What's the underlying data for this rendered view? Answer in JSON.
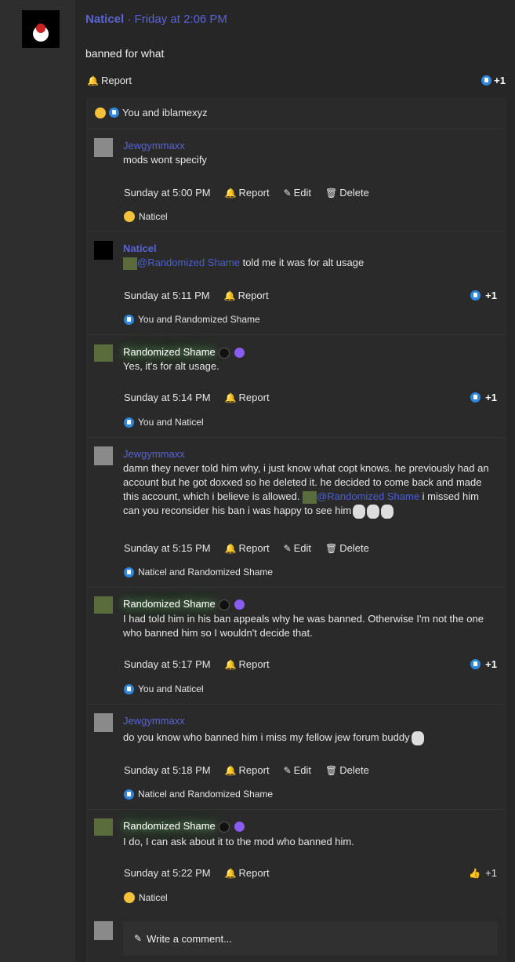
{
  "post": {
    "author": "Naticel",
    "separator": "·",
    "time": "Friday at 2:06 PM",
    "body": "banned for what",
    "report_label": "Report",
    "like_count": "+1",
    "reactions_summary": "You and iblamexyz"
  },
  "comments": [
    {
      "author": "Jewgymmaxx",
      "text": "mods wont specify",
      "time": "Sunday at 5:00 PM",
      "report": "Report",
      "edit": "Edit",
      "delete": "Delete",
      "reaction_text": "Naticel"
    },
    {
      "author": "Naticel",
      "mention": "@Randomized Shame",
      "text": " told me it was for alt usage",
      "time": "Sunday at 5:11 PM",
      "report": "Report",
      "like_count": "+1",
      "reaction_text": "You and Randomized Shame"
    },
    {
      "author": "Randomized Shame",
      "text": "Yes, it's for alt usage.",
      "time": "Sunday at 5:14 PM",
      "report": "Report",
      "like_count": "+1",
      "reaction_text": "You and Naticel"
    },
    {
      "author": "Jewgymmaxx",
      "text_a": "damn they never told him why, i just know what copt knows. he previously had an account but he got doxxed so he deleted it. he decided to come back and made this account, which i believe is allowed.",
      "mention": "@Randomized Shame",
      "text_b": " i missed him",
      "text_c": "can you reconsider his ban i was happy to see him",
      "time": "Sunday at 5:15 PM",
      "report": "Report",
      "edit": "Edit",
      "delete": "Delete",
      "reaction_text": "Naticel and Randomized Shame"
    },
    {
      "author": "Randomized Shame",
      "text": "I had told him in his ban appeals why he was banned. Otherwise I'm not the one who banned him so I wouldn't decide that.",
      "time": "Sunday at 5:17 PM",
      "report": "Report",
      "like_count": "+1",
      "reaction_text": "You and Naticel"
    },
    {
      "author": "Jewgymmaxx",
      "text": "do you know who banned him i miss my fellow jew forum buddy",
      "time": "Sunday at 5:18 PM",
      "report": "Report",
      "edit": "Edit",
      "delete": "Delete",
      "reaction_text": "Naticel and Randomized Shame"
    },
    {
      "author": "Randomized Shame",
      "text": "I do, I can ask about it to the mod who banned him.",
      "time": "Sunday at 5:22 PM",
      "report": "Report",
      "like_count": "+1",
      "reaction_text": "Naticel"
    }
  ],
  "composer": {
    "placeholder": "Write a comment..."
  },
  "colors": {
    "link": "#5a63d6",
    "like": "#2e86de"
  }
}
